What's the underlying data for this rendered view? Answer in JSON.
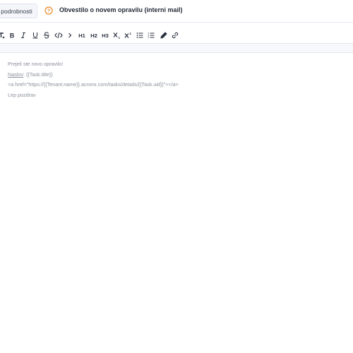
{
  "header": {
    "details_button": "podrobnosti",
    "title": "Obvestilo o novem opravilu (interni mail)",
    "accent_color": "#e8892b"
  },
  "toolbar": {
    "items": [
      {
        "name": "clear-format",
        "icon": "clear-format-icon"
      },
      {
        "name": "bold",
        "icon": "bold-icon"
      },
      {
        "name": "italic",
        "icon": "italic-icon"
      },
      {
        "name": "underline",
        "icon": "underline-icon"
      },
      {
        "name": "strikethrough",
        "icon": "strikethrough-icon"
      },
      {
        "name": "code",
        "icon": "code-icon"
      },
      {
        "name": "blockquote",
        "icon": "chevron-right-icon"
      },
      {
        "name": "heading-1",
        "label": "H1"
      },
      {
        "name": "heading-2",
        "label": "H2"
      },
      {
        "name": "heading-3",
        "label": "H3"
      },
      {
        "name": "subscript",
        "icon": "subscript-icon"
      },
      {
        "name": "superscript",
        "icon": "superscript-icon"
      },
      {
        "name": "bullet-list",
        "icon": "bullet-list-icon"
      },
      {
        "name": "ordered-list",
        "icon": "ordered-list-icon"
      },
      {
        "name": "highlight",
        "icon": "pen-icon"
      },
      {
        "name": "link",
        "icon": "link-icon"
      }
    ]
  },
  "editor": {
    "line1": "Prejeli ste novo opravilo!",
    "line2_label": "Naslov",
    "line2_value": ": {{Task.title}}",
    "line3": "<a href=\"https://{{Tenant.name}}.acronx.com/tasks/details/{{Task.uid}}\"></a>",
    "line4": "Lep pozdrav"
  }
}
